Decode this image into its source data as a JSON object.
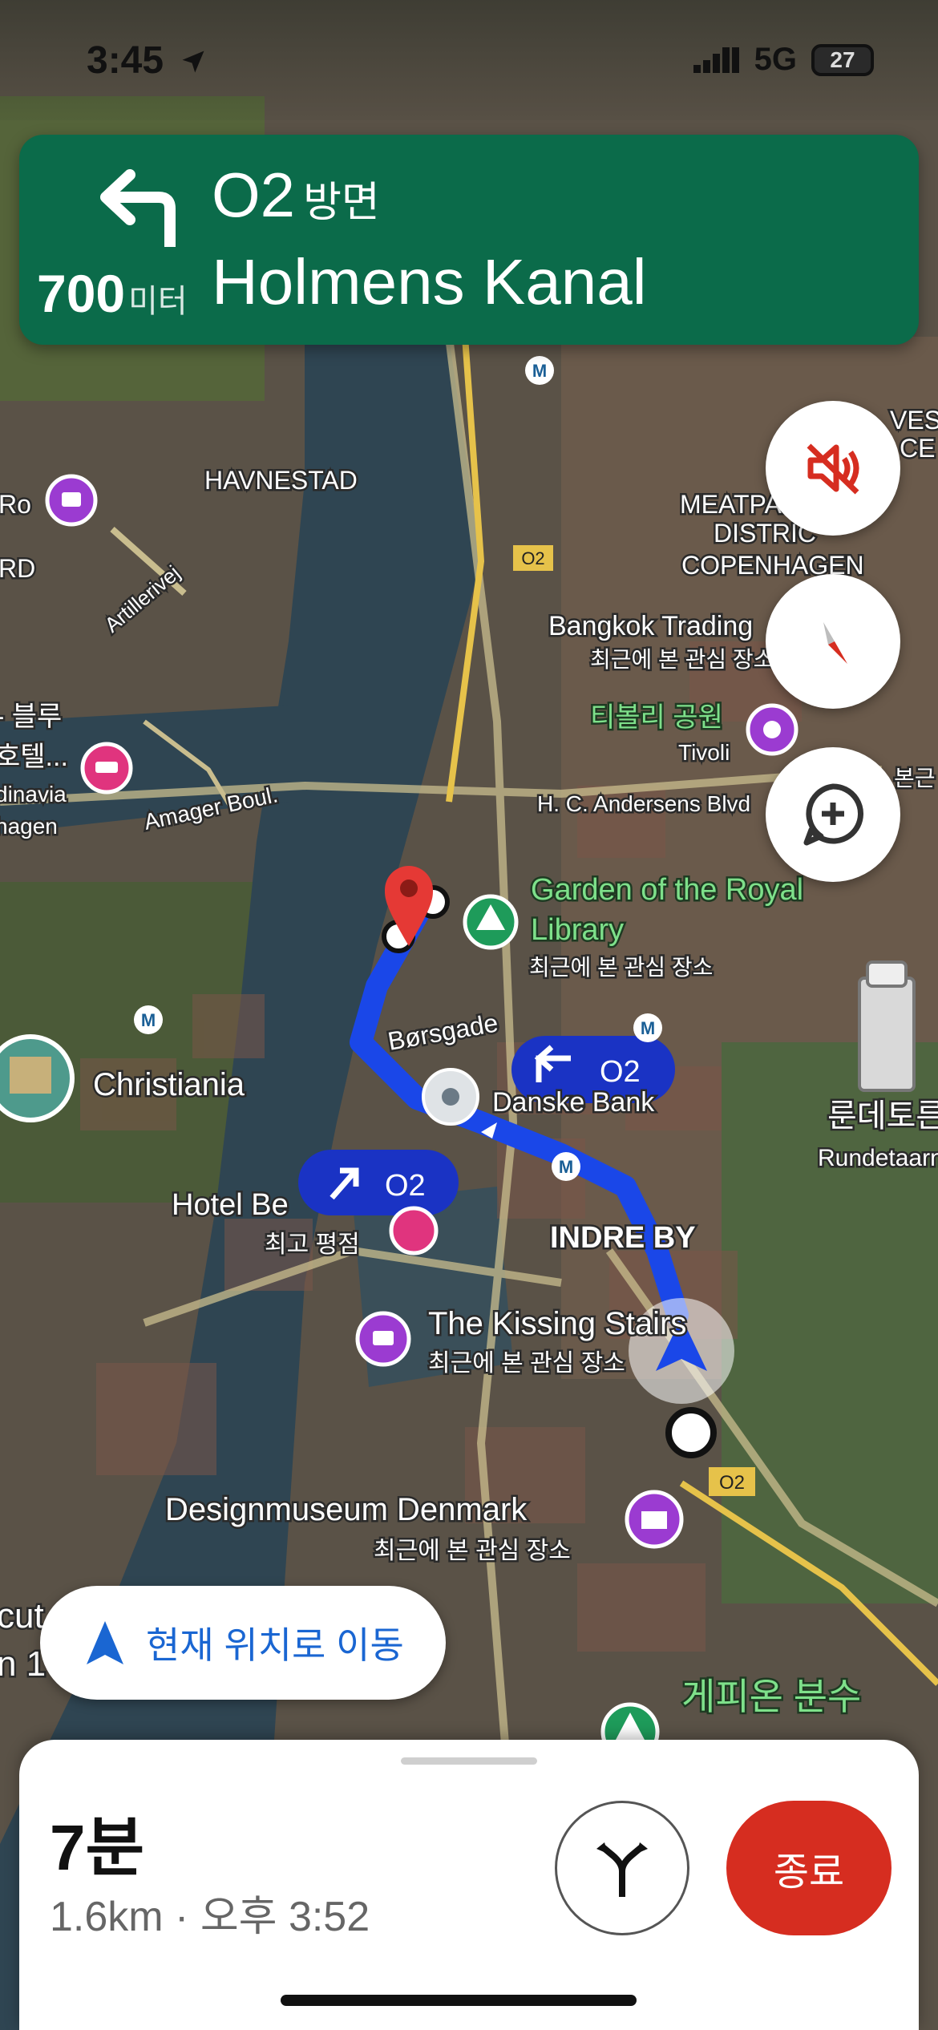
{
  "status_bar": {
    "time": "3:45",
    "network": "5G",
    "battery": "27"
  },
  "nav": {
    "direction_route": "O2",
    "direction_suffix": "방면",
    "distance_value": "700",
    "distance_unit": "미터",
    "street": "Holmens Kanal",
    "turn": "left-turn-arrow-icon"
  },
  "map": {
    "labels": {
      "havnestad": "HAVNESTAD",
      "ro": "Ro",
      "rd": "RD",
      "artillerivej": "Artillerivej",
      "amager_boul": "Amager Boul.",
      "blue_1": "- 블루",
      "hotel_1": "호텔...",
      "dinavia": "dinavia",
      "hagen": "hagen",
      "meatpacking": "MEATPA",
      "district": "DISTRIC",
      "copenhagen": "COPENHAGEN",
      "bangkok": "Bangkok Trading",
      "recently_viewed_1": "최근에 본 관심 장소",
      "tivoli_ko": "티볼리 공원",
      "tivoli": "Tivoli",
      "hc_andersens": "H. C. Andersens Blvd",
      "garden_1": "Garden of the Royal",
      "garden_2": "Library",
      "recently_viewed_2": "최근에 본 관심 장소",
      "borsgade": "Børsgade",
      "danske_bank": "Danske Bank",
      "christiania": "Christiania",
      "hotel_be": "Hotel Be",
      "top_rated": "최고 평점",
      "indre_by": "INDRE BY",
      "kissing_stairs": "The Kissing Stairs",
      "recently_viewed_3": "최근에 본 관심 장소",
      "designmuseum": "Designmuseum Denmark",
      "recently_viewed_4": "최근에 본 관심 장소",
      "gefion": "게피온 분수",
      "rundetarn_ko": "룬데토른",
      "rundetarn": "Rundetaarn",
      "ves": "VES",
      "ce": "CE",
      "bogen_r": "본근",
      "cut": "cut",
      "n1": "n 1",
      "metro": "M",
      "o2_shield": "O2",
      "route_callout_1": "O2",
      "route_callout_2": "O2"
    }
  },
  "controls": {
    "mute": "mute-icon",
    "compass": "compass-icon",
    "report": "add-report-icon"
  },
  "recenter": {
    "label": "현재 위치로 이동"
  },
  "bottom_sheet": {
    "eta_time": "7분",
    "eta_detail": "1.6km · 오후 3:52",
    "exit_label": "종료"
  }
}
